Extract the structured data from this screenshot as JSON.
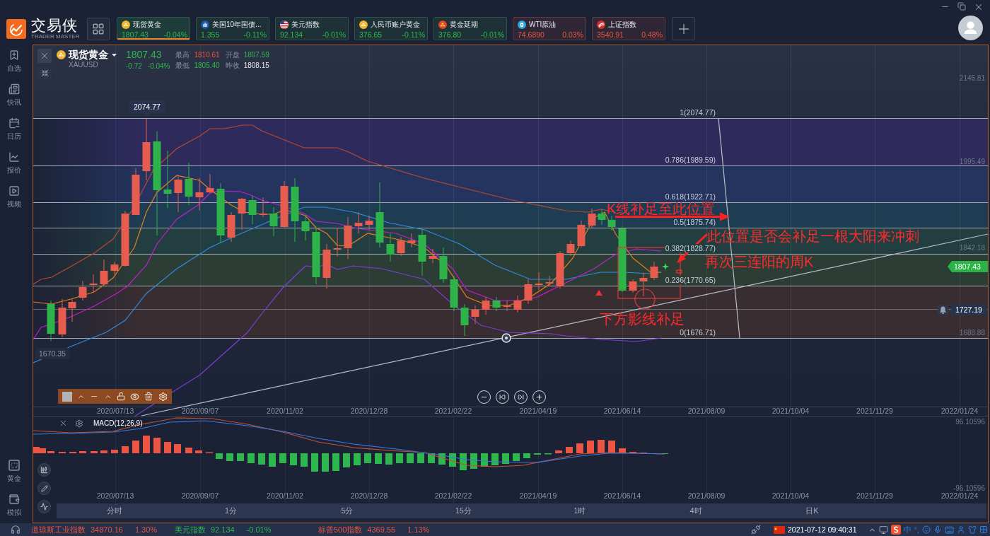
{
  "app": {
    "name": "交易侠",
    "subtitle": "TRADER MASTER"
  },
  "quote_tabs": [
    {
      "name": "现货黄金",
      "price": "1807.43",
      "change": "-0.04%",
      "color": "#2db84d",
      "selected": true
    },
    {
      "name": "美国10年国债...",
      "price": "1.355",
      "change": "-0.11%",
      "color": "#2db84d",
      "selected": false
    },
    {
      "name": "美元指数",
      "price": "92.134",
      "change": "-0.01%",
      "color": "#2db84d",
      "selected": false
    },
    {
      "name": "人民币账户黄金",
      "price": "376.65",
      "change": "-0.11%",
      "color": "#2db84d",
      "selected": false
    },
    {
      "name": "黄金延期",
      "price": "376.80",
      "change": "-0.01%",
      "color": "#2db84d",
      "selected": false
    },
    {
      "name": "WTI原油",
      "price": "74.6890",
      "change": "0.03%",
      "color": "#e9543f",
      "selected": false
    },
    {
      "name": "上证指数",
      "price": "3540.91",
      "change": "0.48%",
      "color": "#e9543f",
      "selected": false
    }
  ],
  "sidebar": {
    "items": [
      {
        "label": "自选"
      },
      {
        "label": "快讯"
      },
      {
        "label": "日历"
      },
      {
        "label": "报价"
      },
      {
        "label": "视频"
      }
    ],
    "bottom_items": [
      {
        "label": "黄金"
      },
      {
        "label": "模拟"
      }
    ]
  },
  "instrument": {
    "name": "现货黄金",
    "symbol": "XAUUSD",
    "price": "1807.43",
    "change": "-0.72",
    "change_percent": "-0.04%",
    "rising": false,
    "stats": [
      {
        "label": "最高",
        "value": "1810.61",
        "color": "#e9543f"
      },
      {
        "label": "开盘",
        "value": "1807.59",
        "color": "#2db84d"
      },
      {
        "label": "最低",
        "value": "1805.40",
        "color": "#2db84d"
      },
      {
        "label": "昨收",
        "value": "1808.15",
        "color": "#e4e7ee"
      }
    ]
  },
  "price_chart": {
    "axis_labels": [
      "2145.81",
      "1995.49",
      "1842.18",
      "1688.88"
    ],
    "high_label": "2074.77",
    "low_label": "1670.35",
    "last_price_tag": "1807.43",
    "alert_price": "1727.19",
    "fibonacci_levels": [
      "1(2074.77)",
      "0.786(1989.59)",
      "0.618(1922.71)",
      "0.5(1875.74)",
      "0.382(1828.77)",
      "0.236(1770.65)",
      "0(1676.71)"
    ],
    "annotations": [
      "K线补足至此位置",
      "此位置是否会补足一根大阳来冲刺",
      "再次三连阳的周K",
      "下方影线补足"
    ],
    "date_labels": [
      "2020/07/13",
      "2020/09/07",
      "2020/11/02",
      "2020/12/28",
      "2021/02/22",
      "2021/04/19",
      "2021/06/14",
      "2021/08/09",
      "2021/10/04",
      "2021/11/29",
      "2022/01/24"
    ]
  },
  "macd": {
    "title": "MACD(12,26,9)",
    "max_label": "96.10596",
    "min_label": "-96.10596",
    "date_labels": [
      "2020/07/13",
      "2020/09/07",
      "2020/11/02",
      "2020/12/28",
      "2021/02/22",
      "2021/04/19",
      "2021/06/14",
      "2021/08/09",
      "2021/10/04",
      "2021/11/29",
      "2022/01/24"
    ]
  },
  "timeframes": [
    {
      "label": "分时"
    },
    {
      "label": "1分"
    },
    {
      "label": "5分"
    },
    {
      "label": "15分"
    },
    {
      "label": "1时"
    },
    {
      "label": "4时"
    },
    {
      "label": "日K"
    }
  ],
  "status_bar": {
    "tickers": [
      {
        "name": "道琼斯工业指数",
        "value": "34870.16",
        "change": "1.30%",
        "color": "#e9543f"
      },
      {
        "name": "美元指数",
        "value": "92.134",
        "change": "-0.01%",
        "color": "#2db84d"
      },
      {
        "name": "标普500指数",
        "value": "4369.55",
        "change": "1.13%",
        "color": "#e9543f"
      }
    ],
    "datetime": "2021-07-12 09:40:31",
    "tray_labels": [
      "中",
      "°,"
    ]
  }
}
